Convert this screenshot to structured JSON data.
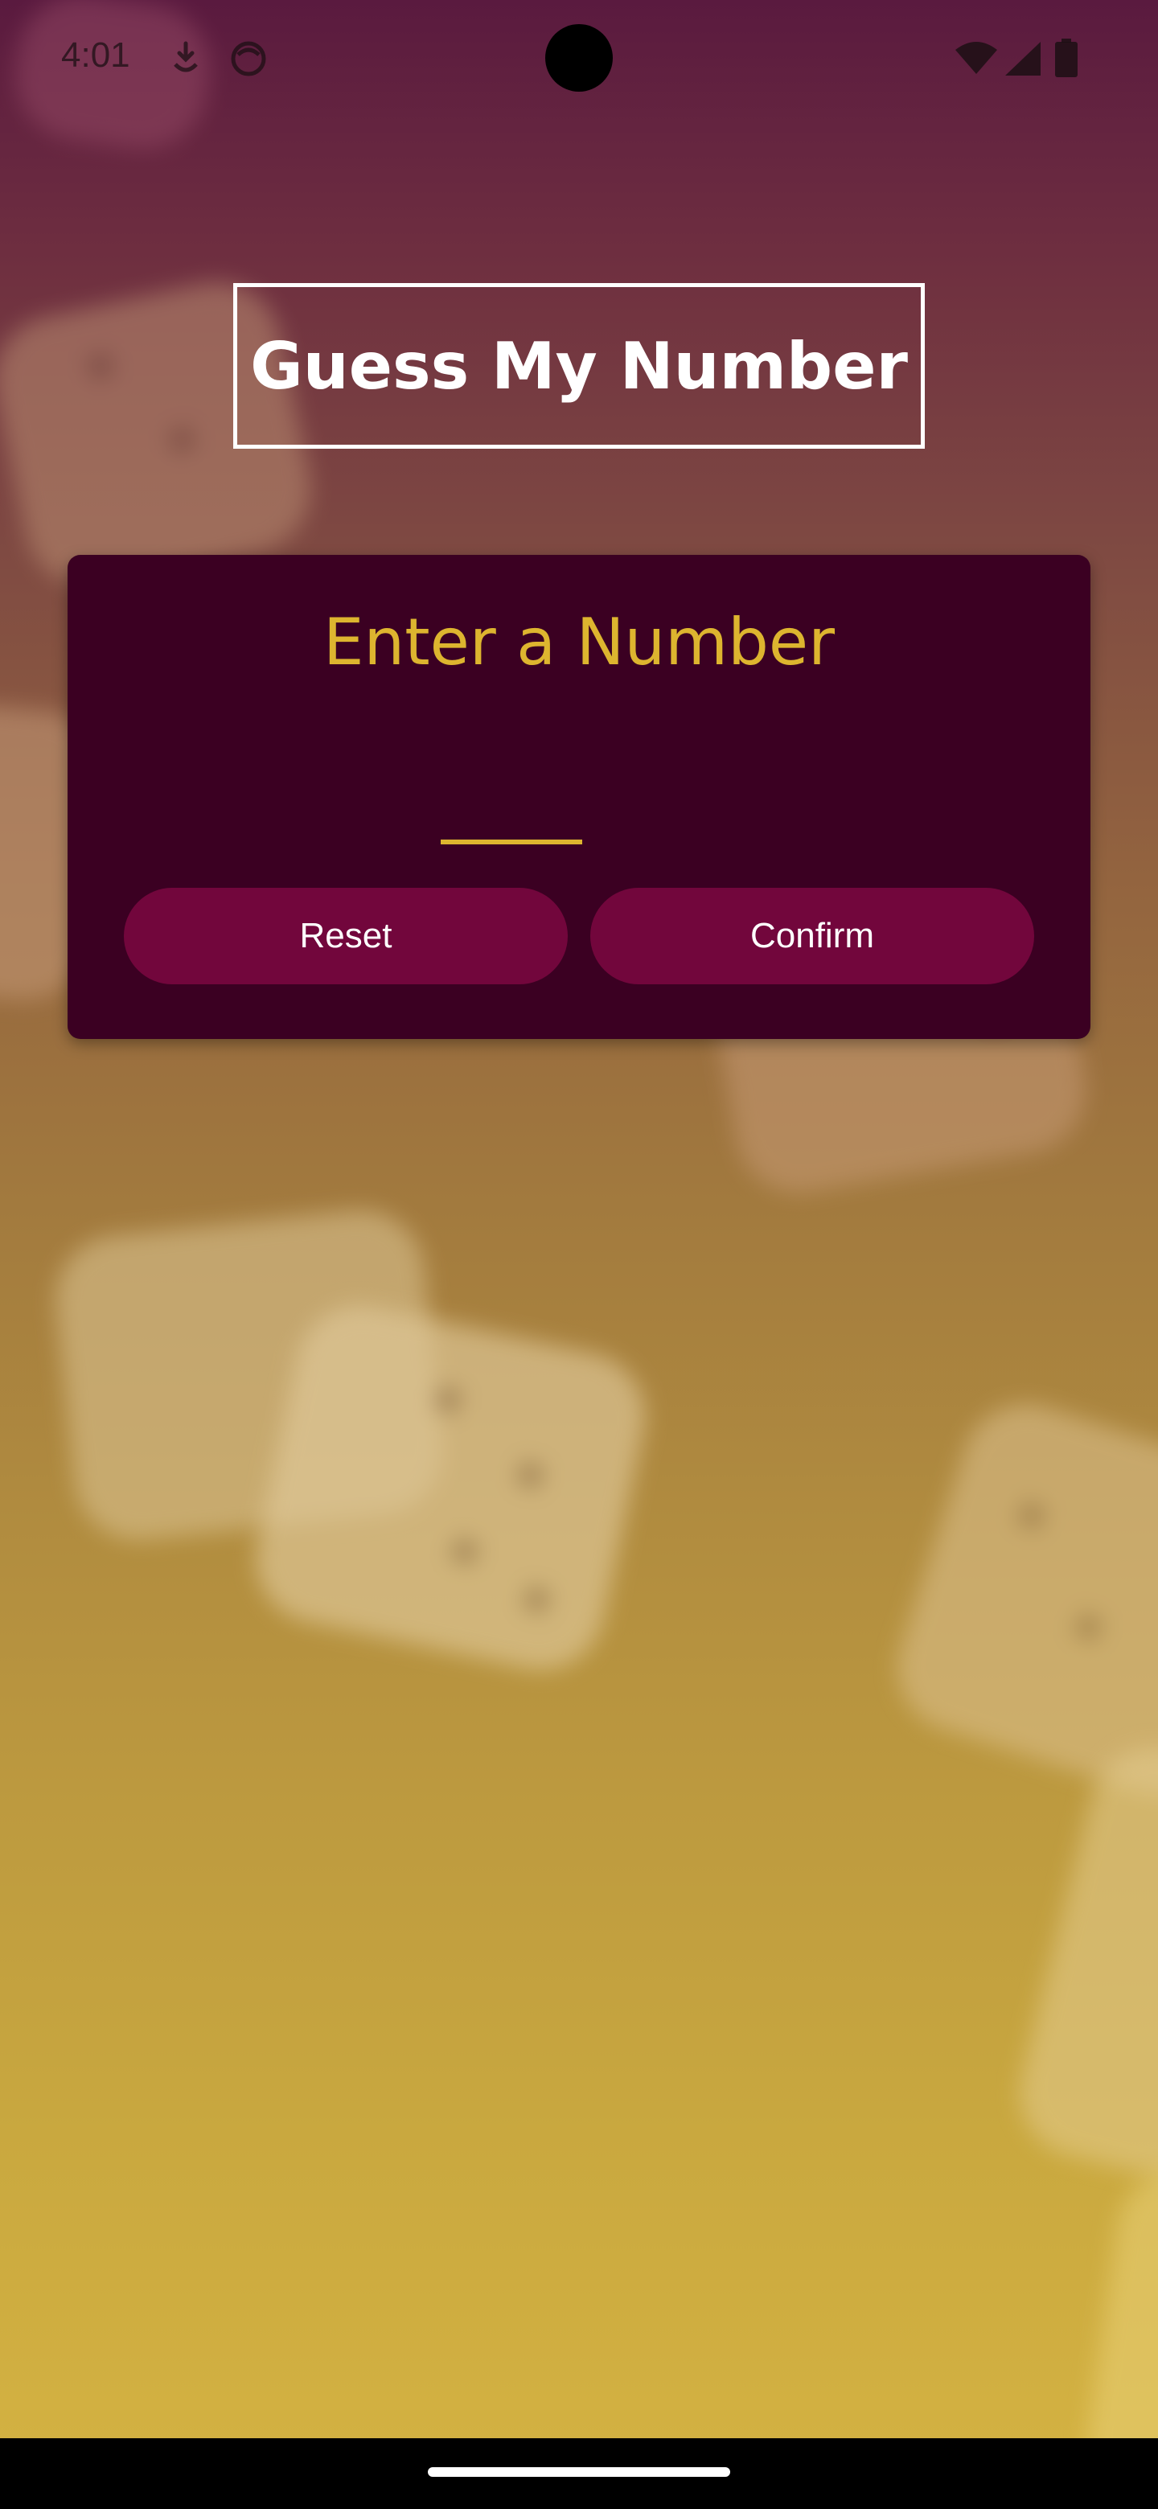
{
  "status_bar": {
    "time": "4:01",
    "icons": [
      "download-icon",
      "face-icon",
      "wifi-icon",
      "signal-icon",
      "battery-icon"
    ]
  },
  "app": {
    "title": "Guess My Number"
  },
  "card": {
    "title": "Enter a Number",
    "input_value": "",
    "reset_label": "Reset",
    "confirm_label": "Confirm"
  },
  "colors": {
    "accent": "#ddb52f",
    "card_background": "#3b0022",
    "button_background": "#72063c",
    "gradient_top": "#5a1a3f",
    "gradient_bottom": "#d5b342"
  }
}
